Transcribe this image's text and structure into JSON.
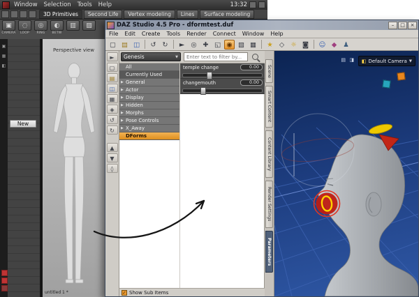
{
  "bg_app": {
    "menubar": {
      "items": [
        "Window",
        "Selection",
        "Tools",
        "Help"
      ],
      "clock": "13:32"
    },
    "tabs": [
      {
        "label": "3D Primitives"
      },
      {
        "label": "Second Life"
      },
      {
        "label": "Vertex modeling"
      },
      {
        "label": "Lines"
      },
      {
        "label": "Surface modeling"
      }
    ],
    "toolbar": {
      "buttons": [
        {
          "name": "camera",
          "glyph": "▣",
          "label": "CAMERA"
        },
        {
          "name": "loop",
          "glyph": "◌",
          "label": "LOOP"
        },
        {
          "name": "ring",
          "glyph": "◎",
          "label": "RING"
        },
        {
          "name": "between",
          "glyph": "◐",
          "label": "BETW"
        },
        {
          "name": "weld",
          "glyph": "▥",
          "label": ""
        },
        {
          "name": "extract",
          "glyph": "▨",
          "label": ""
        }
      ]
    },
    "left_panel": {
      "new_button": "New"
    },
    "viewport": {
      "label": "Perspective view",
      "doc_label": "untitled 1 *"
    }
  },
  "daz": {
    "title": "DAZ Studio 4.5 Pro - dformtest.duf",
    "window_controls": [
      {
        "name": "minimize",
        "glyph": "–"
      },
      {
        "name": "maximize",
        "glyph": "□"
      },
      {
        "name": "close",
        "glyph": "×"
      }
    ],
    "menu": [
      "File",
      "Edit",
      "Create",
      "Tools",
      "Render",
      "Connect",
      "Window",
      "Help"
    ],
    "toolbar_icons": [
      {
        "name": "new-file",
        "glyph": "▢"
      },
      {
        "name": "open-file",
        "glyph": "▤"
      },
      {
        "name": "save-file",
        "glyph": "◫"
      },
      {
        "name": "undo",
        "glyph": "↺"
      },
      {
        "name": "redo",
        "glyph": "↻"
      },
      {
        "name": "node-select-tool",
        "glyph": "►"
      },
      {
        "name": "rotate-tool",
        "glyph": "◎"
      },
      {
        "name": "translate-tool",
        "glyph": "✚"
      },
      {
        "name": "scale-tool",
        "glyph": "◱"
      },
      {
        "name": "universal-tool",
        "glyph": "◉"
      },
      {
        "name": "surface-tool",
        "glyph": "▧"
      },
      {
        "name": "spot-render",
        "glyph": "▦"
      },
      {
        "name": "render",
        "glyph": "★"
      },
      {
        "name": "perspective",
        "glyph": "◇"
      },
      {
        "name": "lights",
        "glyph": "☼"
      },
      {
        "name": "cameras",
        "glyph": "◙"
      },
      {
        "name": "actors",
        "glyph": "☺"
      },
      {
        "name": "wardrobe",
        "glyph": "◆"
      },
      {
        "name": "poses",
        "glyph": "♟"
      }
    ],
    "left_strip_icons": [
      {
        "name": "pointer",
        "glyph": "►"
      },
      {
        "name": "new",
        "glyph": "▢"
      },
      {
        "name": "open",
        "glyph": "▤"
      },
      {
        "name": "save",
        "glyph": "◫"
      },
      {
        "name": "style",
        "glyph": "▦"
      },
      {
        "name": "node",
        "glyph": "◈"
      },
      {
        "name": "undo",
        "glyph": "↺"
      },
      {
        "name": "redo",
        "glyph": "↻"
      },
      {
        "name": "dock-up",
        "glyph": "▲"
      },
      {
        "name": "dock-down",
        "glyph": "▼"
      },
      {
        "name": "multi",
        "glyph": "◊"
      }
    ],
    "params": {
      "figure": "Genesis",
      "dropdown_arrow": "▼",
      "filter_placeholder": "Enter text to filter by...",
      "groups": [
        {
          "label": "All"
        },
        {
          "label": "Currently Used"
        },
        {
          "label": "General",
          "arrow": "▶"
        },
        {
          "label": "Actor",
          "arrow": "▶"
        },
        {
          "label": "Display",
          "arrow": "▶"
        },
        {
          "label": "Hidden",
          "arrow": "▶"
        },
        {
          "label": "Morphs",
          "arrow": "▶"
        },
        {
          "label": "Pose Controls",
          "arrow": "▶"
        },
        {
          "label": "X_Away",
          "arrow": "▶"
        },
        {
          "label": "DForms"
        }
      ],
      "sliders": [
        {
          "label": "temple change",
          "value": "0.00"
        },
        {
          "label": "changemouth",
          "value": "0.00"
        }
      ],
      "footer": {
        "check_glyph": "✓",
        "label": "Show Sub Items"
      }
    },
    "side_tabs": [
      {
        "label": "Scene"
      },
      {
        "label": "Smart Content"
      },
      {
        "label": "Content Library"
      },
      {
        "label": "Render Settings"
      },
      {
        "label": "Parameters"
      }
    ],
    "viewport": {
      "camera": "Default Camera",
      "camera_arrow": "▼",
      "camera_icon": "◧",
      "mini_icons": [
        {
          "name": "pane-options",
          "glyph": "▤"
        },
        {
          "name": "draw-style",
          "glyph": "◨"
        }
      ]
    }
  },
  "colors": {
    "accent_orange": "#e8962d",
    "dform_red": "#c22616",
    "dform_yellow": "#eec800",
    "viewport_blue": "#1c3b7c"
  }
}
